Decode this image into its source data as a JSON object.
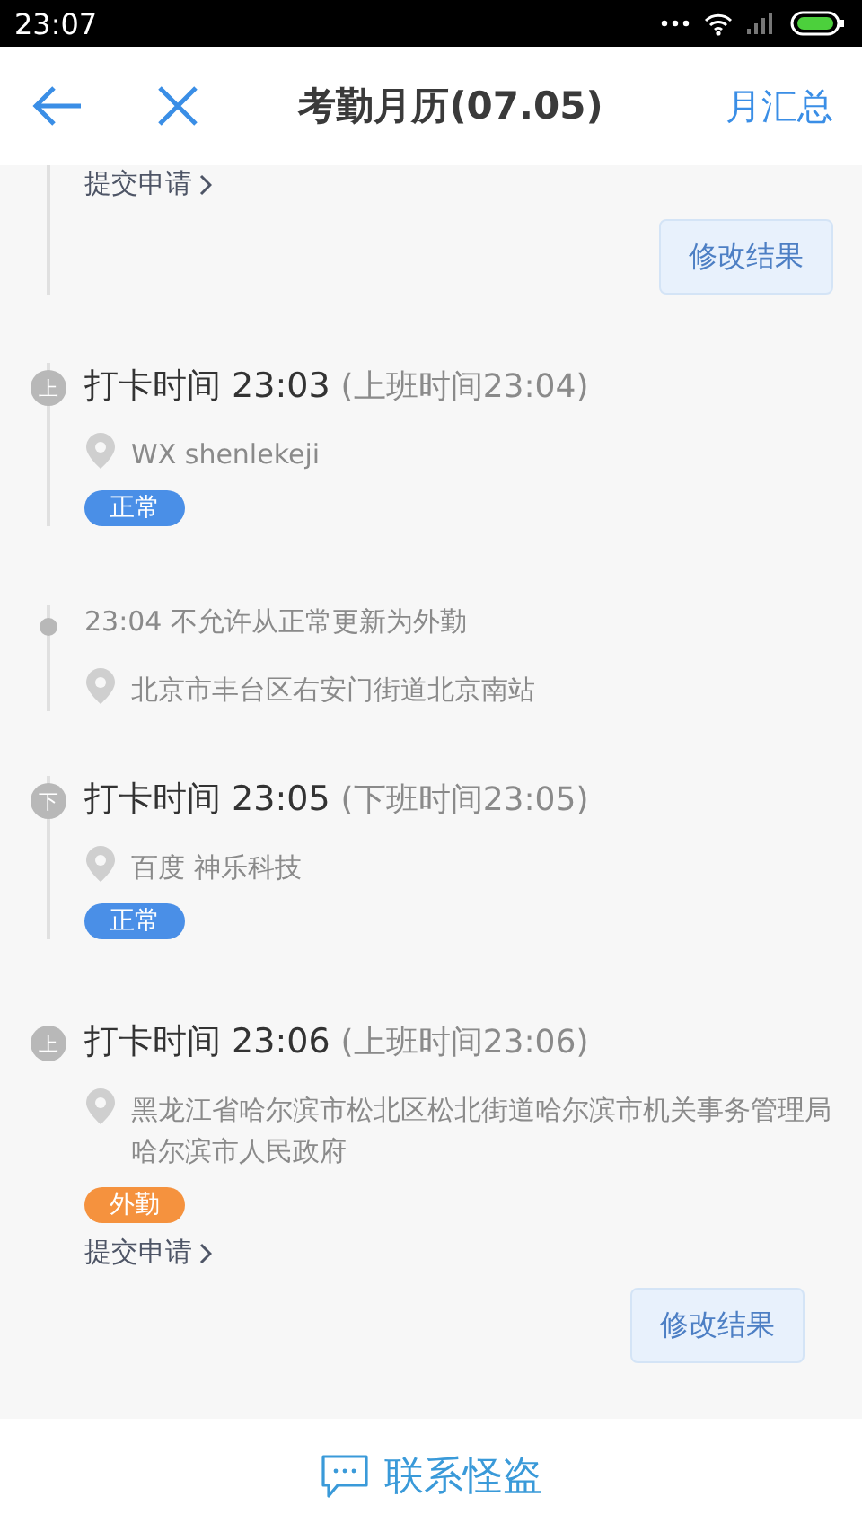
{
  "status_bar": {
    "time": "23:07"
  },
  "header": {
    "title": "考勤月历(07.05)",
    "action": "月汇总"
  },
  "entries": [
    {
      "kind": "actions",
      "link": "提交申请",
      "button": "修改结果"
    },
    {
      "kind": "punch",
      "badge": "上",
      "time": "打卡时间 23:03",
      "scheduled": "(上班时间23:04)",
      "location": "WX shenlekeji",
      "tag": {
        "text": "正常",
        "color": "#4a8fe7"
      }
    },
    {
      "kind": "note",
      "text": "23:04 不允许从正常更新为外勤",
      "location": "北京市丰台区右安门街道北京南站"
    },
    {
      "kind": "punch",
      "badge": "下",
      "time": "打卡时间 23:05",
      "scheduled": "(下班时间23:05)",
      "location": "百度 神乐科技",
      "tag": {
        "text": "正常",
        "color": "#4a8fe7"
      }
    },
    {
      "kind": "punch",
      "badge": "上",
      "time": "打卡时间 23:06",
      "scheduled": "(上班时间23:06)",
      "location": "黑龙江省哈尔滨市松北区松北街道哈尔滨市机关事务管理局哈尔滨市人民政府",
      "tag": {
        "text": "外勤",
        "color": "#f5923e"
      },
      "link": "提交申请",
      "button": "修改结果"
    }
  ],
  "footer": {
    "label": "联系怪盗"
  }
}
